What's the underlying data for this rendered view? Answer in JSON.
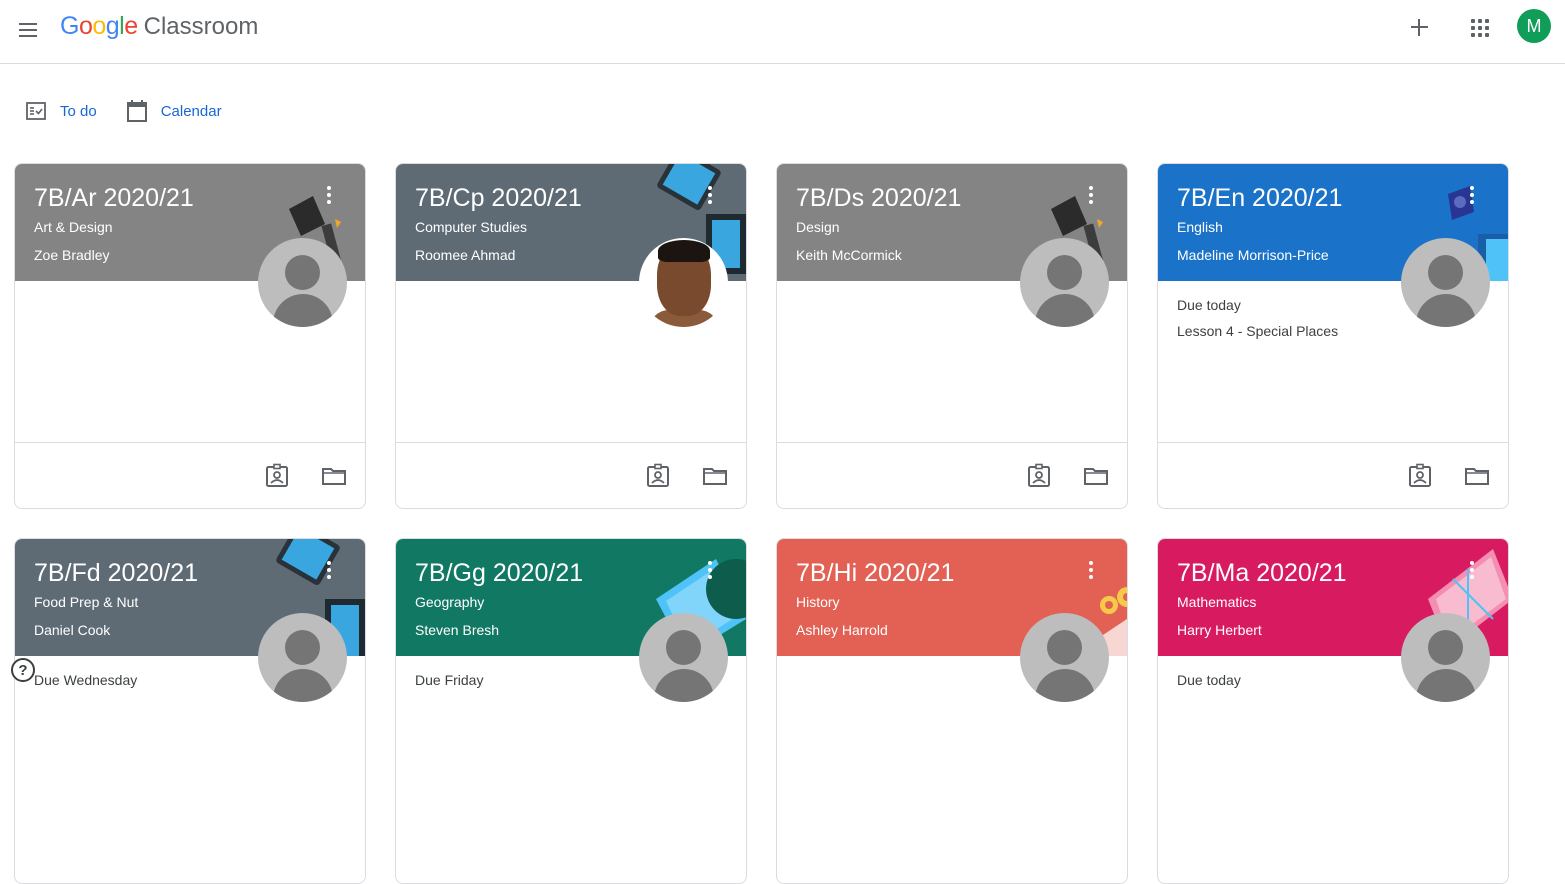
{
  "header": {
    "brand_google": "Google",
    "brand_product": "Classroom",
    "account_initial": "M"
  },
  "subnav": {
    "todo_label": "To do",
    "calendar_label": "Calendar"
  },
  "cards": [
    {
      "title": "7B/Ar 2020/21",
      "subject": "Art & Design",
      "teacher": "Zoe Bradley",
      "color": "#848484",
      "due_label": "",
      "due_item": ""
    },
    {
      "title": "7B/Cp 2020/21",
      "subject": "Computer Studies",
      "teacher": "Roomee Ahmad",
      "color": "#5f6b74",
      "due_label": "",
      "due_item": ""
    },
    {
      "title": "7B/Ds 2020/21",
      "subject": "Design",
      "teacher": "Keith McCormick",
      "color": "#848484",
      "due_label": "",
      "due_item": ""
    },
    {
      "title": "7B/En 2020/21",
      "subject": "English",
      "teacher": "Madeline Morrison-Price",
      "color": "#1a73c8",
      "due_label": "Due today",
      "due_item": "Lesson 4 - Special Places"
    },
    {
      "title": "7B/Fd 2020/21",
      "subject": "Food Prep & Nut",
      "teacher": "Daniel Cook",
      "color": "#5f6b74",
      "due_label": "Due Wednesday",
      "due_item": ""
    },
    {
      "title": "7B/Gg 2020/21",
      "subject": "Geography",
      "teacher": "Steven Bresh",
      "color": "#107863",
      "due_label": "Due Friday",
      "due_item": ""
    },
    {
      "title": "7B/Hi 2020/21",
      "subject": "History",
      "teacher": "Ashley Harrold",
      "color": "#e26154",
      "due_label": "",
      "due_item": ""
    },
    {
      "title": "7B/Ma 2020/21",
      "subject": "Mathematics",
      "teacher": "Harry Herbert",
      "color": "#d81b60",
      "due_label": "Due today",
      "due_item": ""
    }
  ],
  "help": {
    "label": "?"
  }
}
